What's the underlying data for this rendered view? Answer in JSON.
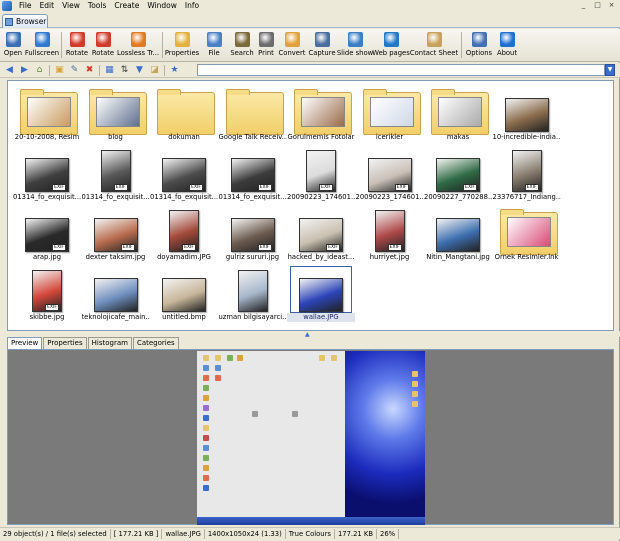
{
  "menu": [
    "File",
    "Edit",
    "View",
    "Tools",
    "Create",
    "Window",
    "Info"
  ],
  "window_controls": {
    "minimize": "_",
    "maximize": "□",
    "close": "×"
  },
  "tab": {
    "label": "Browser"
  },
  "toolbar": [
    {
      "label": "Open",
      "icon": "eye-icon",
      "color": "#3b6fb4"
    },
    {
      "label": "Fullscreen",
      "icon": "fullscreen-icon",
      "color": "#2f7ad0"
    },
    {
      "label": "Rotate",
      "icon": "rotate-left-icon",
      "color": "#d23a2a"
    },
    {
      "label": "Rotate",
      "icon": "rotate-right-icon",
      "color": "#d23a2a"
    },
    {
      "label": "Lossless Tr...",
      "icon": "lossless-transform-icon",
      "color": "#e07b22"
    },
    {
      "label": "Properties",
      "icon": "properties-icon",
      "color": "#e3b23c"
    },
    {
      "label": "File",
      "icon": "file-icon",
      "color": "#4b7fc6"
    },
    {
      "label": "Search",
      "icon": "search-icon",
      "color": "#7b6a3b"
    },
    {
      "label": "Print",
      "icon": "print-icon",
      "color": "#6c6c6c"
    },
    {
      "label": "Convert",
      "icon": "convert-icon",
      "color": "#e2a13a"
    },
    {
      "label": "Capture",
      "icon": "camera-icon",
      "color": "#4a6da0"
    },
    {
      "label": "Slide show",
      "icon": "slideshow-icon",
      "color": "#3a7fc4"
    },
    {
      "label": "Web pages",
      "icon": "globe-icon",
      "color": "#1f78c8"
    },
    {
      "label": "Contact Sheet",
      "icon": "contact-sheet-icon",
      "color": "#c9a25a"
    },
    {
      "label": "Options",
      "icon": "options-icon",
      "color": "#4270b2"
    },
    {
      "label": "About",
      "icon": "help-icon",
      "color": "#1f6fd0"
    }
  ],
  "navbar": {
    "back": "◀",
    "forward": "▶",
    "up": "⌂",
    "new_folder": "▣",
    "edit": "✎",
    "delete": "✖",
    "view": "▦",
    "sort": "⇅",
    "filter": "▼",
    "tag": "◪",
    "favorites": "★",
    "path_placeholder": "",
    "path_dropdown": "▼"
  },
  "thumbnails": [
    {
      "name": "20-10-2008, Resim",
      "kind": "folder",
      "color": "#c89b5c"
    },
    {
      "name": "blog",
      "kind": "folder",
      "color": "#5f6f8e"
    },
    {
      "name": "dokuman",
      "kind": "folder-empty",
      "color": ""
    },
    {
      "name": "Google Talk Receiv...",
      "kind": "folder-empty",
      "color": ""
    },
    {
      "name": "Gorulmemis Fotolar",
      "kind": "folder",
      "color": "#9a6b4a"
    },
    {
      "name": "icerikler",
      "kind": "folder",
      "color": "#cfd8e8"
    },
    {
      "name": "makas",
      "kind": "folder",
      "color": "#a9a9a9"
    },
    {
      "name": "10-incredible-india...",
      "kind": "image",
      "color": "#8c6e4e"
    },
    {
      "name": "01314_fo_exquisit...",
      "kind": "image",
      "color": "#404040"
    },
    {
      "name": "01314_fo_exquisit...",
      "kind": "image",
      "color": "#5a5a5a"
    },
    {
      "name": "01314_fo_exquisit...",
      "kind": "image",
      "color": "#4d4d4d"
    },
    {
      "name": "01314_fo_exquisit...",
      "kind": "image",
      "color": "#3c3c3c"
    },
    {
      "name": "20090223_174601...",
      "kind": "image",
      "color": "#dcdcdc"
    },
    {
      "name": "20090223_174601...",
      "kind": "image",
      "color": "#c9c0b8"
    },
    {
      "name": "20090227_770288...",
      "kind": "image",
      "color": "#2f6b45"
    },
    {
      "name": "23376717_Indiang...",
      "kind": "image",
      "color": "#8a7f70"
    },
    {
      "name": "arap.jpg",
      "kind": "image",
      "color": "#2a2a2a"
    },
    {
      "name": "dexter taksim.jpg",
      "kind": "image",
      "color": "#b86c4e"
    },
    {
      "name": "doyamadim.JPG",
      "kind": "image",
      "color": "#a34a3a"
    },
    {
      "name": "gulriz sururi.jpg",
      "kind": "image",
      "color": "#6b5a4e"
    },
    {
      "name": "hacked_by_ideast...",
      "kind": "image",
      "color": "#c9c0b0"
    },
    {
      "name": "hurriyet.jpg",
      "kind": "image",
      "color": "#b04a4a"
    },
    {
      "name": "Nitin_Mangtani.jpg",
      "kind": "image",
      "color": "#3d6fb0"
    },
    {
      "name": "Ornek Resimler.lnk",
      "kind": "folder",
      "color": "#d84a78"
    },
    {
      "name": "skibbe.jpg",
      "kind": "image",
      "color": "#d4483a"
    },
    {
      "name": "teknolojicafe_main...",
      "kind": "image",
      "color": "#6f8fbf"
    },
    {
      "name": "untitled.bmp",
      "kind": "image",
      "color": "#c8b79b"
    },
    {
      "name": "uzman bilgisayarci...",
      "kind": "image",
      "color": "#a8b8cc"
    },
    {
      "name": "wallae.JPG",
      "kind": "image",
      "color": "#2c45b8",
      "selected": true
    }
  ],
  "exif_label": "EXIF",
  "splitter_glyph": "▲",
  "preview_tabs": [
    "Preview",
    "Properties",
    "Histogram",
    "Categories"
  ],
  "status": [
    "29 object(s) / 1 file(s) selected",
    "[ 177.21 KB ]",
    "wallae.JPG",
    "1400x1050x24 (1.33)",
    "True Colours",
    "177.21 KB",
    "26%"
  ]
}
